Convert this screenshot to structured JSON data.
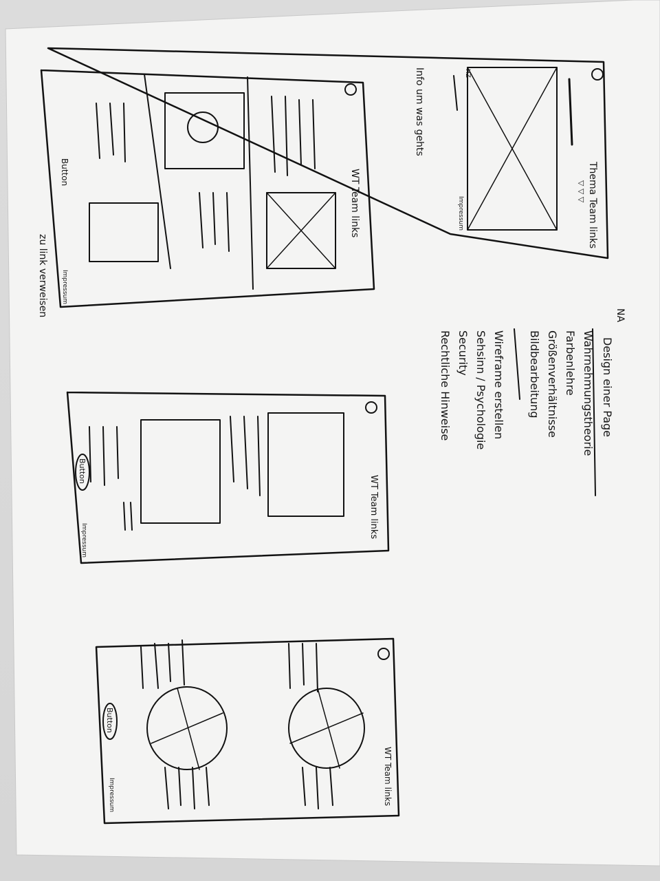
{
  "sketch1": {
    "header_title": "Thema Team links",
    "header_arrows": "▽ ▽ ▽",
    "footer_label": "Impressum",
    "nav_label": "HZ",
    "annotation": "Info um was gehts"
  },
  "sketch2": {
    "header_title": "WT Team links",
    "button_label": "Button",
    "footer_label": "Impressum",
    "annotation": "zu link verweisen"
  },
  "sketch3": {
    "header_title": "WT Team links",
    "button_label": "Button",
    "footer_label": "Impressum"
  },
  "sketch4": {
    "header_title": "WT Team links",
    "button_label": "Button",
    "footer_label": "Impressum"
  },
  "notes": {
    "heading": "Design einer Page",
    "marker": "NA",
    "items": [
      "Wahrnehmungstheorie",
      "Farbenlehre",
      "Größenverhältnisse",
      "Bildbearbeitung",
      "Wireframe erstellen",
      "Sehsinn / Psychologie",
      "Security",
      "Rechtliche Hinweise"
    ]
  }
}
